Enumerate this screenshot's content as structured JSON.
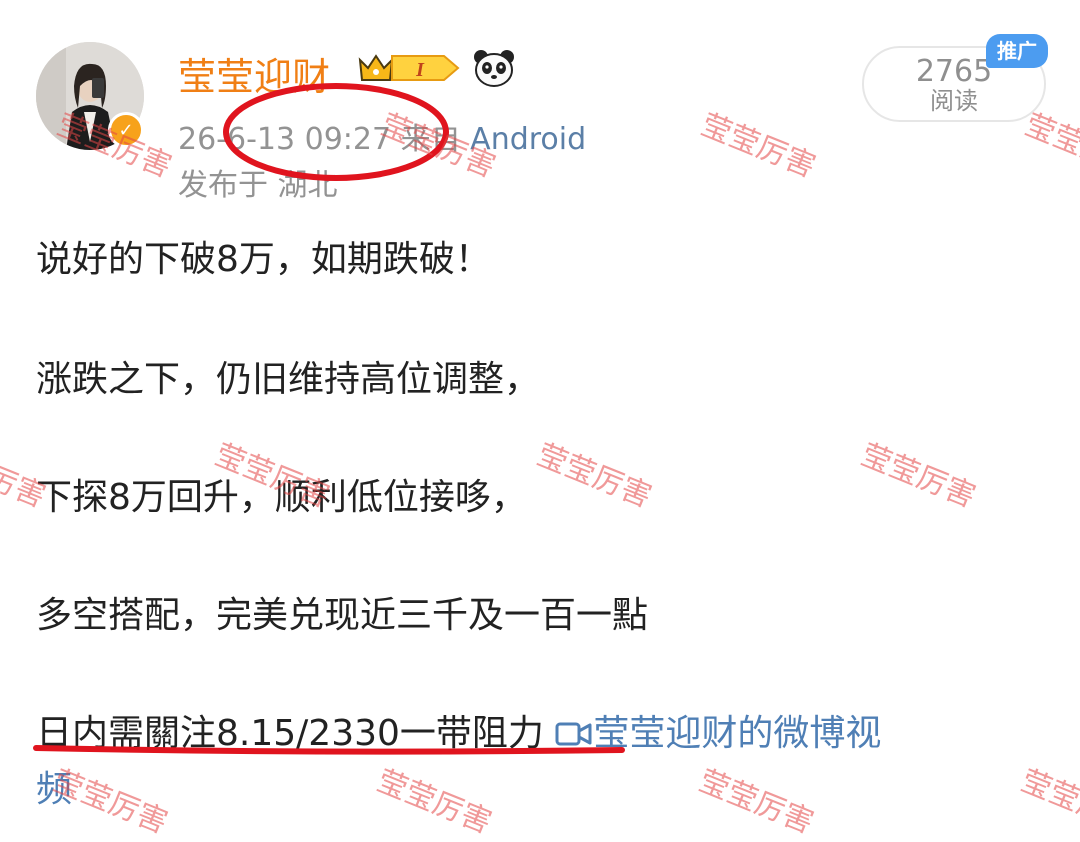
{
  "post": {
    "username": "莹莹迎财",
    "vip_level": "I",
    "time": "26-6-13 09:27",
    "source_prefix": "来自",
    "source": "Android",
    "location": "发布于 湖北",
    "ad_tag": "推广",
    "read_count": "2765",
    "read_label": "阅读"
  },
  "content": {
    "lines": [
      "说好的下破8万，如期跌破！",
      "涨跌之下，仍旧维持高位调整，",
      "下探8万回升，顺利低位接哆，",
      "多空搭配，完美兑现近三千及一百一點",
      "日内需關注8.15/2330一带阻力"
    ],
    "video_link": "莹莹迎财的微博视",
    "video_link_wrap": "频"
  },
  "watermark": "莹莹厉害",
  "colors": {
    "username": "#f07f15",
    "link": "#5b7fa7",
    "ad_tag": "#4c9cf0",
    "annotation": "#e0141e",
    "watermark": "#e44646"
  },
  "icons": [
    "verified-icon",
    "crown-icon",
    "vip-badge-icon",
    "panda-icon",
    "video-icon"
  ]
}
